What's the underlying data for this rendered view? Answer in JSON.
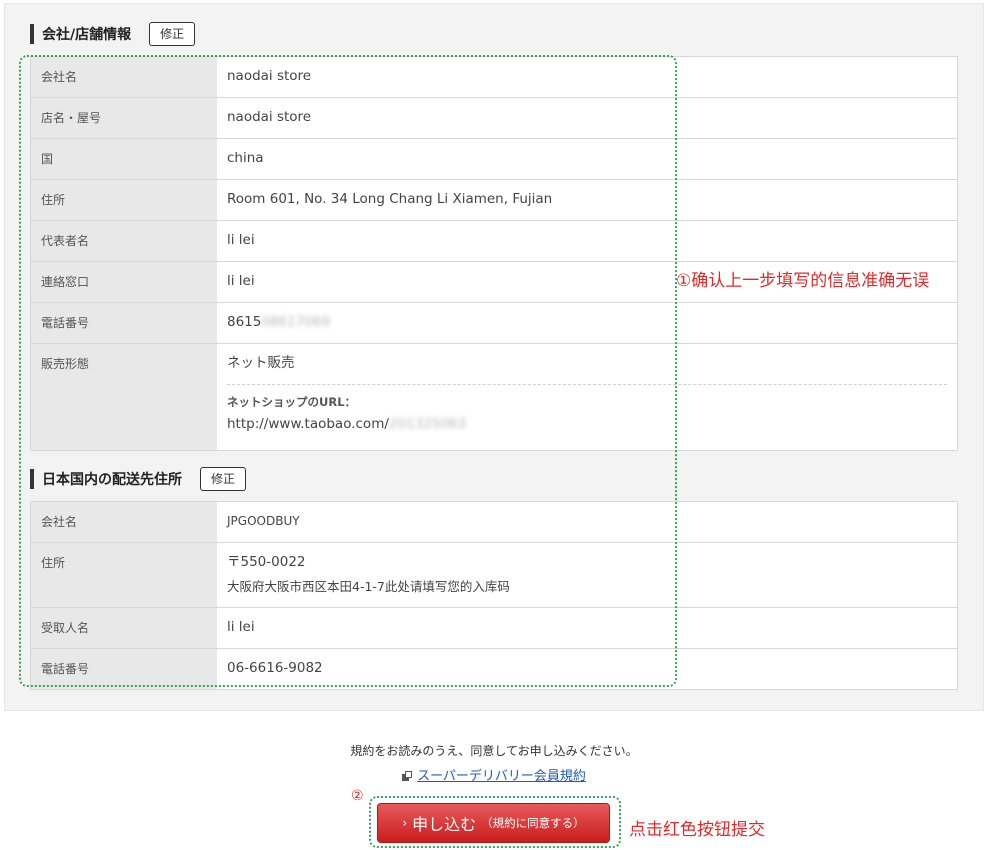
{
  "section1": {
    "title": "会社/店舗情報",
    "edit_label": "修正",
    "rows": [
      {
        "label": "会社名",
        "value": "naodai store"
      },
      {
        "label": "店名・屋号",
        "value": "naodai store"
      },
      {
        "label": "国",
        "value": "china"
      },
      {
        "label": "住所",
        "value": "Room 601, No. 34 Long Chang Li Xiamen, Fujian"
      },
      {
        "label": "代表者名",
        "value": "li lei"
      },
      {
        "label": "連絡窓口",
        "value": "li lei"
      },
      {
        "label": "電話番号",
        "value": "8615",
        "value_blurred": "08617069"
      },
      {
        "label": "販売形態",
        "value": "ネット販売",
        "shop_url_label": "ネットショップのURL：",
        "shop_url": "http://www.taobao.com/",
        "shop_url_blurred": "201325063"
      }
    ]
  },
  "section2": {
    "title": "日本国内の配送先住所",
    "edit_label": "修正",
    "rows": [
      {
        "label": "会社名",
        "value": "JPGOODBUY"
      },
      {
        "label": "住所",
        "value": "〒550-0022",
        "value2": "大阪府大阪市西区本田4-1-7此处请填写您的入库码"
      },
      {
        "label": "受取人名",
        "value": "li lei"
      },
      {
        "label": "電話番号",
        "value": "06-6616-9082"
      }
    ]
  },
  "annotations": {
    "step1": "①确认上一步填写的信息准确无误",
    "step2_marker": "②",
    "step2": "点击红色按钮提交"
  },
  "footer": {
    "agree_text": "規約をお読みのうえ、同意してお申し込みください。",
    "terms_link": "スーパーデリバリー会員規約",
    "submit_arrow": "›",
    "submit_main": "申し込む",
    "submit_sub": "（規約に同意する）"
  },
  "colors": {
    "annotation_red": "#e02a2a",
    "annotation_green": "#38a55a",
    "submit_red": "#d33636",
    "link_blue": "#1f5bbf"
  }
}
